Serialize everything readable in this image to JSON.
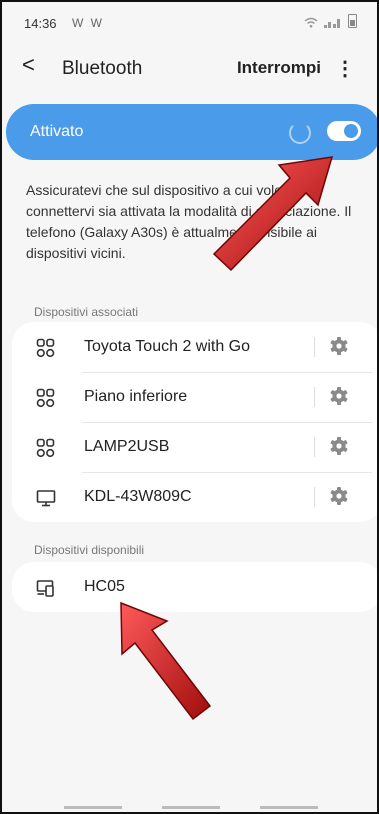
{
  "status_bar": {
    "time": "14:36",
    "left_icons": "W W"
  },
  "app_bar": {
    "title": "Bluetooth",
    "stop_label": "Interrompi",
    "more_label": "⋮",
    "back_label": "<"
  },
  "master": {
    "label": "Attivato",
    "on": true
  },
  "description": "Assicuratevi che sul dispositivo a cui volete connettervi sia attivata la modalità di associazione. Il telefono (Galaxy A30s) è attualmente visibile ai dispositivi vicini.",
  "paired_section": {
    "title": "Dispositivi associati",
    "devices": [
      {
        "name": "Toyota Touch 2 with Go",
        "icon": "car-link-icon"
      },
      {
        "name": "Piano inferiore",
        "icon": "car-link-icon"
      },
      {
        "name": "LAMP2USB",
        "icon": "car-link-icon"
      },
      {
        "name": "KDL-43W809C",
        "icon": "monitor-icon"
      }
    ]
  },
  "available_section": {
    "title": "Dispositivi disponibili",
    "devices": [
      {
        "name": "HC05",
        "icon": "devices-icon"
      }
    ]
  },
  "colors": {
    "accent": "#4a9be9",
    "background": "#f6f6f6",
    "card": "#ffffff",
    "annotation_arrow": "#c62020"
  }
}
